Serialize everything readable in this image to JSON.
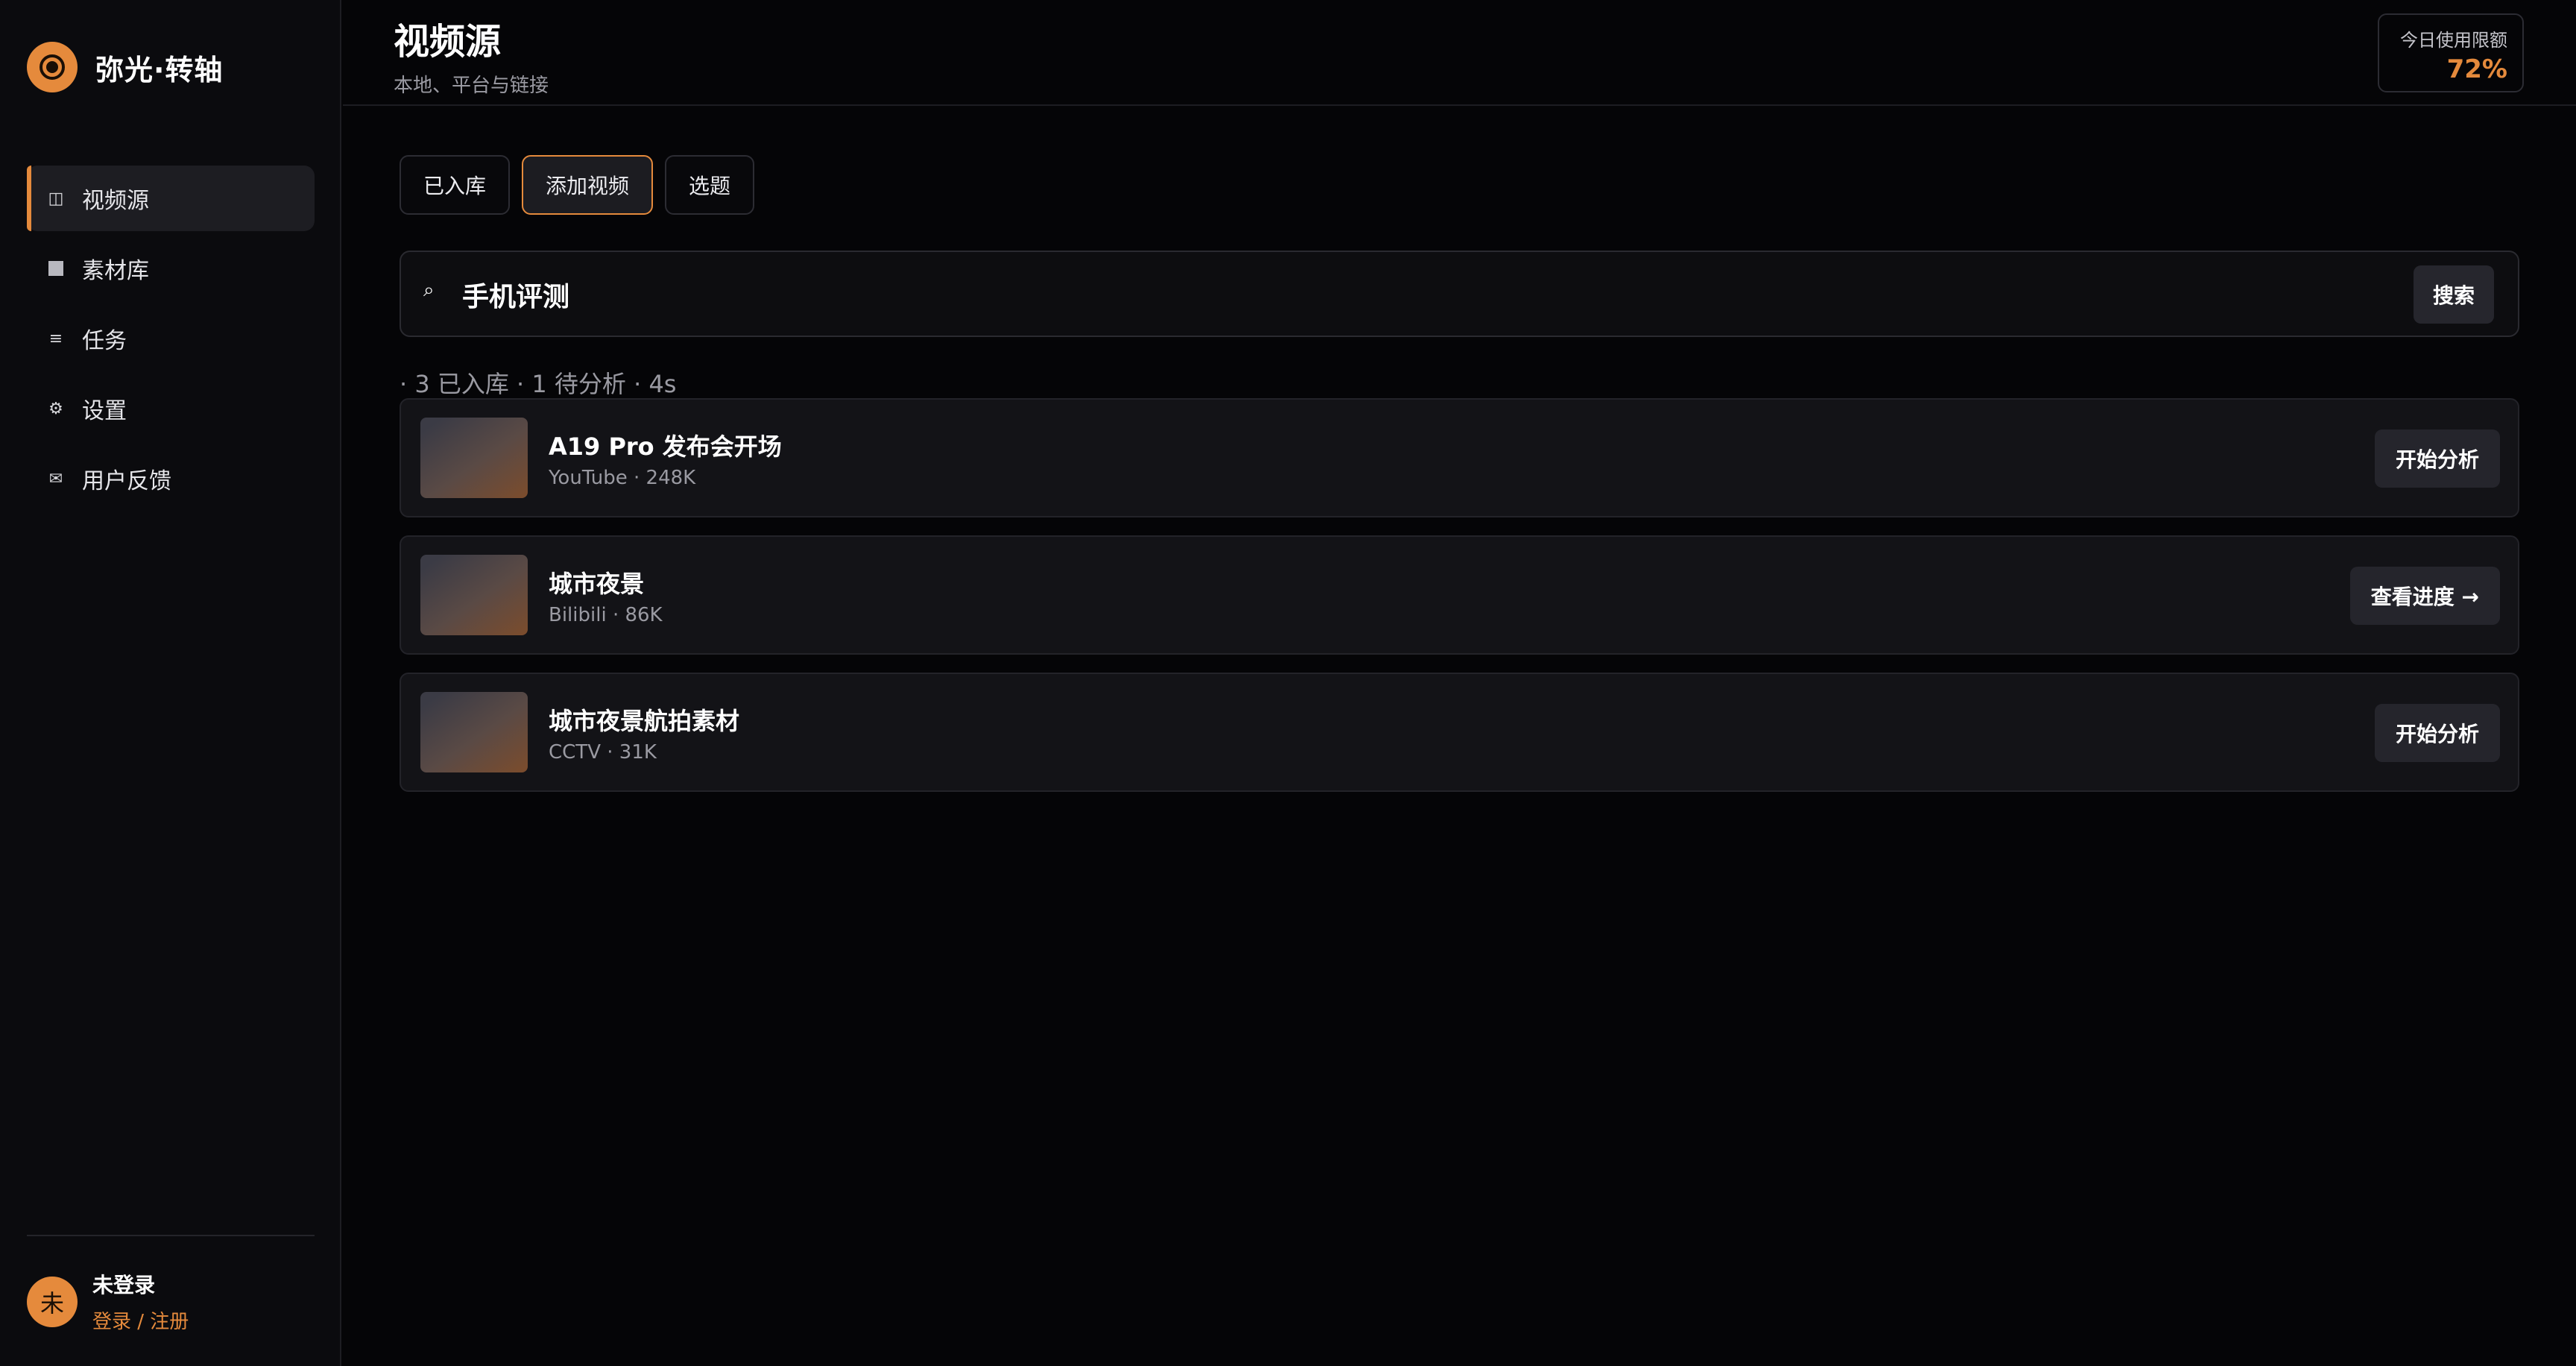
{
  "brand": {
    "name": "弥光·转轴"
  },
  "sidebar": {
    "items": [
      {
        "label": "视频源",
        "icon": "columns-icon",
        "glyph": "◫",
        "active": true
      },
      {
        "label": "素材库",
        "icon": "square-icon",
        "glyph": "",
        "active": false
      },
      {
        "label": "任务",
        "icon": "list-icon",
        "glyph": "≡",
        "active": false
      },
      {
        "label": "设置",
        "icon": "gear-icon",
        "glyph": "⚙",
        "active": false
      },
      {
        "label": "用户反馈",
        "icon": "mail-icon",
        "glyph": "✉",
        "active": false
      }
    ]
  },
  "user": {
    "avatar": "未",
    "name": "未登录",
    "login_link": "登录 / 注册"
  },
  "header": {
    "title": "视频源",
    "subtitle": "本地、平台与链接",
    "quota_label": "今日使用限额",
    "quota_value": "72%"
  },
  "tabs": [
    {
      "label": "已入库",
      "active": false
    },
    {
      "label": "添加视频",
      "active": true
    },
    {
      "label": "选题",
      "active": false
    }
  ],
  "search": {
    "icon": "⌕",
    "value": "手机评测",
    "button_label": "搜索"
  },
  "summary": "· 3 已入库 · 1 待分析 · 4s",
  "results": [
    {
      "title": "A19 Pro 发布会开场",
      "meta": "YouTube · 248K",
      "action": "开始分析"
    },
    {
      "title": "城市夜景",
      "meta": "Bilibili · 86K",
      "action": "查看进度 →"
    },
    {
      "title": "城市夜景航拍素材",
      "meta": "CCTV · 31K",
      "action": "开始分析"
    }
  ],
  "colors": {
    "accent": "#e58a3c",
    "background": "#050507",
    "sidebar": "#0b0b0e",
    "card": "#131317"
  }
}
